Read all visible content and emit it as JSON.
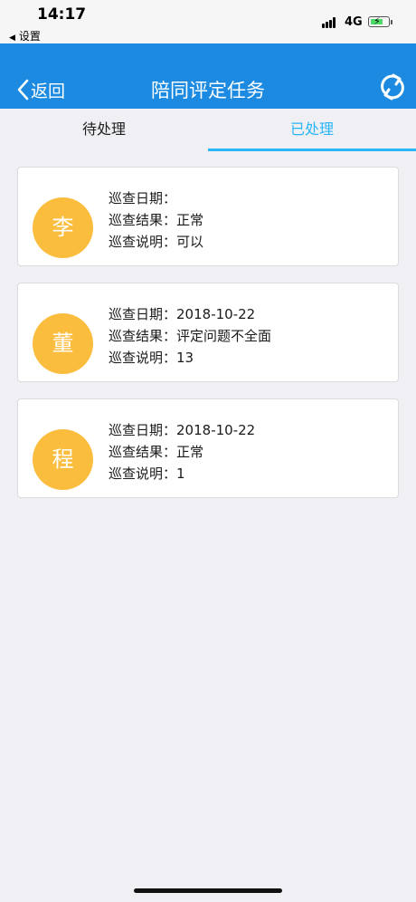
{
  "status_bar": {
    "time": "14:17",
    "back_app": "设置",
    "network": "4G",
    "battery_fraction": 0.7,
    "icons": [
      "signal-icon",
      "battery-charging-icon",
      "back-triangle-icon"
    ]
  },
  "nav": {
    "back_label": "返回",
    "title": "陪同评定任务",
    "refresh_icon": "refresh-icon",
    "back_icon": "chevron-left-icon",
    "color": "#1b8ae0"
  },
  "tabs": {
    "pending_label": "待处理",
    "done_label": "已处理",
    "active": "已处理",
    "active_color": "#29b6f6"
  },
  "cards": [
    {
      "avatar": "李",
      "date_label": "巡查日期：",
      "date": "",
      "result_label": "巡查结果：",
      "result": "正常",
      "note_label": "巡查说明：",
      "note": "可以"
    },
    {
      "avatar": "董",
      "date_label": "巡查日期：",
      "date": "2018-10-22",
      "result_label": "巡查结果：",
      "result": "评定问题不全面",
      "note_label": "巡查说明：",
      "note": "13"
    },
    {
      "avatar": "程",
      "date_label": "巡查日期：",
      "date": "2018-10-22",
      "result_label": "巡查结果：",
      "result": "正常",
      "note_label": "巡查说明：",
      "note": "1"
    }
  ],
  "avatar_color": "#fbbd3e"
}
